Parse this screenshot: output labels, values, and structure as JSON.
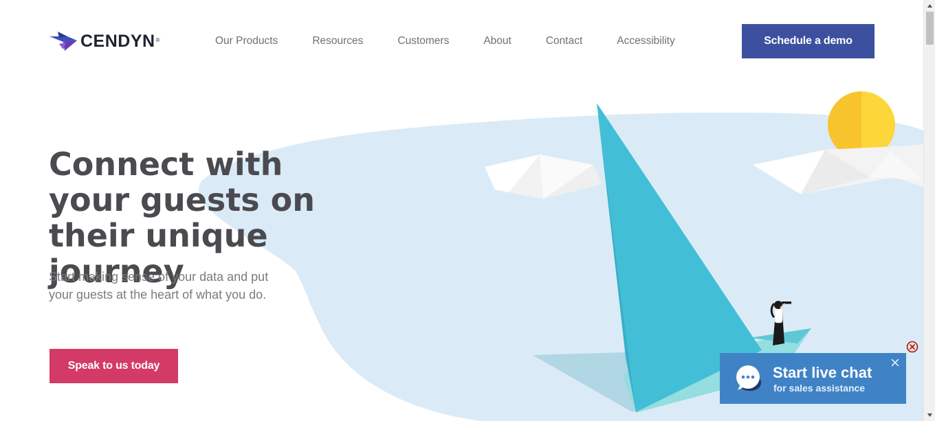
{
  "brand": {
    "name": "CENDYN",
    "registered_mark": "®",
    "colors": {
      "logo_blue": "#3c4fbf",
      "logo_purple": "#6a3ab0",
      "logo_text": "#1c2430",
      "primary": "#3d50a0",
      "accent": "#d33a66",
      "chat": "#3f83c6",
      "sky": "#daebf7",
      "sail": "#42bfd6",
      "sun": "#fdd63a"
    }
  },
  "header": {
    "nav": [
      {
        "label": "Our Products"
      },
      {
        "label": "Resources"
      },
      {
        "label": "Customers"
      },
      {
        "label": "About"
      },
      {
        "label": "Contact"
      },
      {
        "label": "Accessibility"
      }
    ],
    "cta_label": "Schedule a demo"
  },
  "hero": {
    "title": "Connect with your guests on their unique journey",
    "subtitle": "Start making sense of your data and put your guests at the heart of what you do.",
    "cta_label": "Speak to us today"
  },
  "chat": {
    "title": "Start live chat",
    "subtitle": "for sales assistance",
    "icon": "chat-bubble-icon",
    "close_icon": "close-icon"
  },
  "icons": {
    "scroll_up": "chevron-up-icon",
    "scroll_down": "chevron-down-icon"
  }
}
